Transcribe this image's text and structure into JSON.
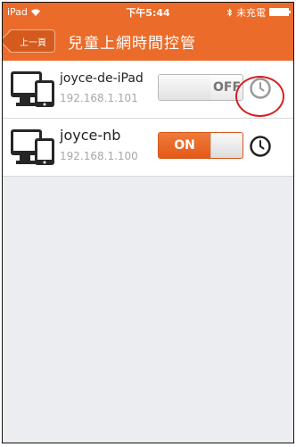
{
  "status_bar": {
    "device": "iPad",
    "time": "下午5:44",
    "charging": "未充電",
    "wifi_icon": "wifi-icon",
    "bluetooth_icon": "bluetooth-icon",
    "battery_icon": "battery-icon"
  },
  "nav": {
    "back_label": "上一頁",
    "title": "兒童上網時間控管"
  },
  "devices": [
    {
      "name": "joyce-de-iPad",
      "ip": "192.168.1.101",
      "toggle_label": "OFF",
      "state": "off"
    },
    {
      "name": "joyce-nb",
      "ip": "192.168.1.100",
      "toggle_label": "ON",
      "state": "on"
    }
  ],
  "colors": {
    "accent": "#ea6b2a",
    "highlight": "#d62020",
    "background": "#ecedf0"
  }
}
